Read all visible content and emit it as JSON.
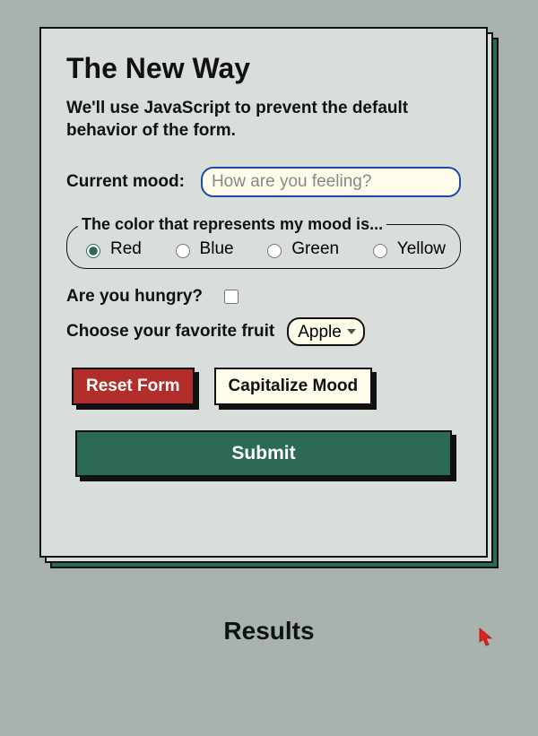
{
  "heading": "The New Way",
  "subheading": "We'll use JavaScript to prevent the default behavior of the form.",
  "mood": {
    "label": "Current mood:",
    "placeholder": "How are you feeling?",
    "value": ""
  },
  "color": {
    "legend": "The color that represents my mood is...",
    "options": [
      "Red",
      "Blue",
      "Green",
      "Yellow"
    ],
    "selected": "Red"
  },
  "hungry": {
    "label": "Are you hungry?",
    "checked": false
  },
  "fruit": {
    "label": "Choose your favorite fruit",
    "selected": "Apple"
  },
  "buttons": {
    "reset": "Reset Form",
    "capitalize": "Capitalize Mood",
    "submit": "Submit"
  },
  "results_heading": "Results"
}
